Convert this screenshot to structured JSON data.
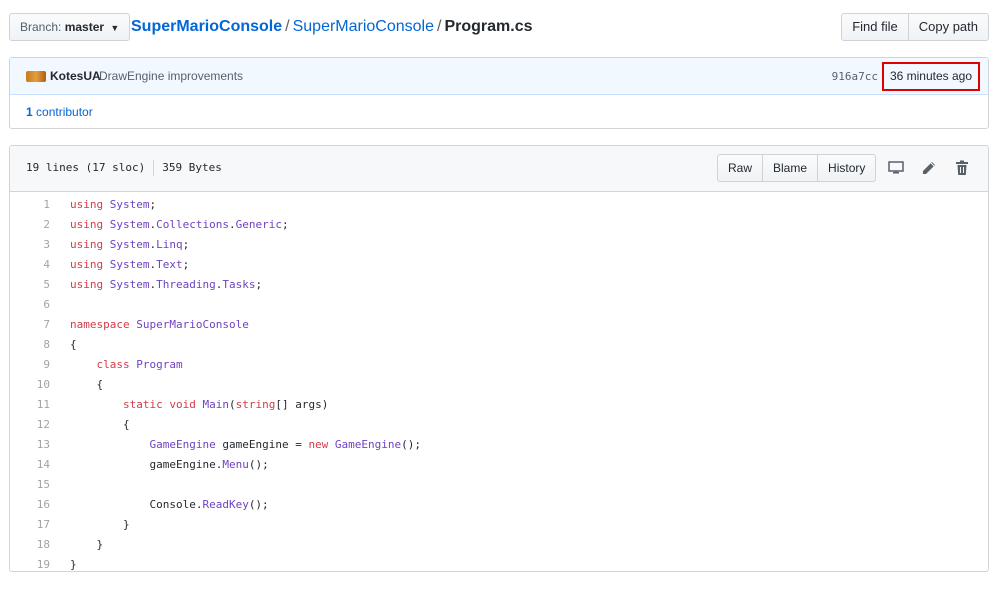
{
  "branch": {
    "label": "Branch:",
    "value": "master"
  },
  "breadcrumb": {
    "root": "SuperMarioConsole",
    "folder": "SuperMarioConsole",
    "file": "Program.cs",
    "separator": "/"
  },
  "toolbar": {
    "find_file": "Find file",
    "copy_path": "Copy path"
  },
  "commit": {
    "author": "KotesUA",
    "message": "DrawEngine improvements",
    "sha": "916a7cc",
    "time": "36 minutes ago"
  },
  "contributors": {
    "count": "1",
    "label": "contributor"
  },
  "file_info": {
    "lines": "19 lines (17 sloc)",
    "size": "359 Bytes"
  },
  "file_actions": {
    "raw": "Raw",
    "blame": "Blame",
    "history": "History"
  },
  "icons": {
    "desktop": "desktop-icon",
    "edit": "pencil-icon",
    "delete": "trash-icon"
  },
  "colors": {
    "keyword": "#d73a49",
    "type": "#6f42c1",
    "link": "#0366d6",
    "highlight_border": "#e00000"
  },
  "code_lines": [
    {
      "n": "1",
      "tokens": [
        [
          "kw",
          "using"
        ],
        [
          "",
          ""
        ],
        [
          "ty",
          " System"
        ],
        [
          "",
          ";"
        ]
      ]
    },
    {
      "n": "2",
      "tokens": [
        [
          "kw",
          "using"
        ],
        [
          "ty",
          " System"
        ],
        [
          "",
          "."
        ],
        [
          "ty",
          "Collections"
        ],
        [
          "",
          "."
        ],
        [
          "ty",
          "Generic"
        ],
        [
          "",
          ";"
        ]
      ]
    },
    {
      "n": "3",
      "tokens": [
        [
          "kw",
          "using"
        ],
        [
          "ty",
          " System"
        ],
        [
          "",
          "."
        ],
        [
          "ty",
          "Linq"
        ],
        [
          "",
          ";"
        ]
      ]
    },
    {
      "n": "4",
      "tokens": [
        [
          "kw",
          "using"
        ],
        [
          "ty",
          " System"
        ],
        [
          "",
          "."
        ],
        [
          "ty",
          "Text"
        ],
        [
          "",
          ";"
        ]
      ]
    },
    {
      "n": "5",
      "tokens": [
        [
          "kw",
          "using"
        ],
        [
          "ty",
          " System"
        ],
        [
          "",
          "."
        ],
        [
          "ty",
          "Threading"
        ],
        [
          "",
          "."
        ],
        [
          "ty",
          "Tasks"
        ],
        [
          "",
          ";"
        ]
      ]
    },
    {
      "n": "6",
      "tokens": []
    },
    {
      "n": "7",
      "tokens": [
        [
          "kw",
          "namespace"
        ],
        [
          "ty",
          " SuperMarioConsole"
        ]
      ]
    },
    {
      "n": "8",
      "tokens": [
        [
          "",
          "{"
        ]
      ]
    },
    {
      "n": "9",
      "tokens": [
        [
          "",
          "    "
        ],
        [
          "kw",
          "class"
        ],
        [
          "ty",
          " Program"
        ]
      ]
    },
    {
      "n": "10",
      "tokens": [
        [
          "",
          "    {"
        ]
      ]
    },
    {
      "n": "11",
      "tokens": [
        [
          "",
          "        "
        ],
        [
          "kw",
          "static"
        ],
        [
          "kw",
          " void"
        ],
        [
          "ty",
          " Main"
        ],
        [
          "",
          "("
        ],
        [
          "kw",
          "string"
        ],
        [
          "",
          "[] args)"
        ]
      ]
    },
    {
      "n": "12",
      "tokens": [
        [
          "",
          "        {"
        ]
      ]
    },
    {
      "n": "13",
      "tokens": [
        [
          "",
          "            "
        ],
        [
          "ty",
          "GameEngine"
        ],
        [
          "",
          " gameEngine = "
        ],
        [
          "kw",
          "new"
        ],
        [
          "ty",
          " GameEngine"
        ],
        [
          "",
          "();"
        ]
      ]
    },
    {
      "n": "14",
      "tokens": [
        [
          "",
          "            gameEngine."
        ],
        [
          "ty",
          "Menu"
        ],
        [
          "",
          "();"
        ]
      ]
    },
    {
      "n": "15",
      "tokens": []
    },
    {
      "n": "16",
      "tokens": [
        [
          "",
          "            Console."
        ],
        [
          "ty",
          "ReadKey"
        ],
        [
          "",
          "();"
        ]
      ]
    },
    {
      "n": "17",
      "tokens": [
        [
          "",
          "        }"
        ]
      ]
    },
    {
      "n": "18",
      "tokens": [
        [
          "",
          "    }"
        ]
      ]
    },
    {
      "n": "19",
      "tokens": [
        [
          "",
          "}"
        ]
      ]
    }
  ]
}
